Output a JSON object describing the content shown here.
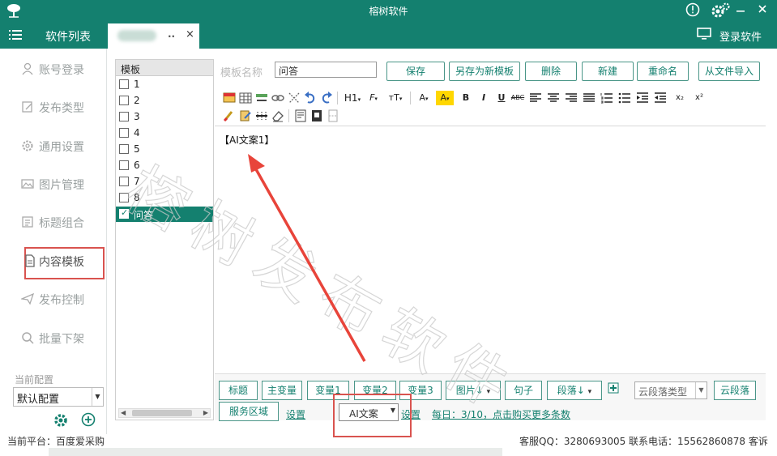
{
  "window": {
    "title": "榕树软件"
  },
  "tabbar": {
    "menu_label": "软件列表",
    "tab_close": "×",
    "tab_dots": "..",
    "login_label": "登录软件"
  },
  "sidebar": {
    "items": [
      {
        "label": "账号登录",
        "icon": "user-icon"
      },
      {
        "label": "发布类型",
        "icon": "edit-icon"
      },
      {
        "label": "通用设置",
        "icon": "settings-icon"
      },
      {
        "label": "图片管理",
        "icon": "image-icon"
      },
      {
        "label": "标题组合",
        "icon": "list-icon"
      },
      {
        "label": "内容模板",
        "icon": "document-icon",
        "active": true
      },
      {
        "label": "发布控制",
        "icon": "send-icon"
      },
      {
        "label": "批量下架",
        "icon": "search-icon"
      }
    ],
    "config_label": "当前配置",
    "config_value": "默认配置"
  },
  "template_list": {
    "header": "模板",
    "items": [
      {
        "label": "1",
        "checked": false
      },
      {
        "label": "2",
        "checked": false
      },
      {
        "label": "3",
        "checked": false
      },
      {
        "label": "4",
        "checked": false
      },
      {
        "label": "5",
        "checked": false
      },
      {
        "label": "6",
        "checked": false
      },
      {
        "label": "7",
        "checked": false
      },
      {
        "label": "8",
        "checked": false
      },
      {
        "label": "问答",
        "checked": true
      }
    ],
    "scroll_thumb": "III"
  },
  "editor": {
    "name_label": "模板名称",
    "name_value": "问答",
    "buttons": {
      "save": "保存",
      "save_as": "另存为新模板",
      "delete": "删除",
      "new": "新建",
      "rename": "重命名",
      "import": "从文件导入"
    },
    "toolbar": {
      "h1": "H1",
      "font": "F",
      "font_size": "T",
      "font_color": "A",
      "highlight": "A",
      "bold": "B",
      "italic": "I",
      "underline": "U",
      "strike": "ABC",
      "subscript": "x₂",
      "superscript": "x²",
      "highlight_color": "#ffd700"
    },
    "content": "【AI文案1】"
  },
  "bottom": {
    "buttons": {
      "title": "标题",
      "main_var": "主变量",
      "var1": "变量1",
      "var2": "变量2",
      "var3": "变量3",
      "image": "图片↓",
      "sentence": "句子",
      "paragraph": "段落↓",
      "cloud_para": "云段落",
      "service_area": "服务区域"
    },
    "cloud_para_type": "云段落类型",
    "ai_select": "AI文案",
    "settings_link_1": "设置",
    "settings_link_2": "设置",
    "daily_link": "每日：3/10，点击购买更多条数"
  },
  "status": {
    "platform": "当前平台：百度爱采购",
    "contact": "客服QQ：3280693005   联系电话：15562860878   客诉"
  },
  "watermark": "榕树发布软件",
  "colors": {
    "accent": "#14806f",
    "highlight_box": "#d9534f"
  }
}
